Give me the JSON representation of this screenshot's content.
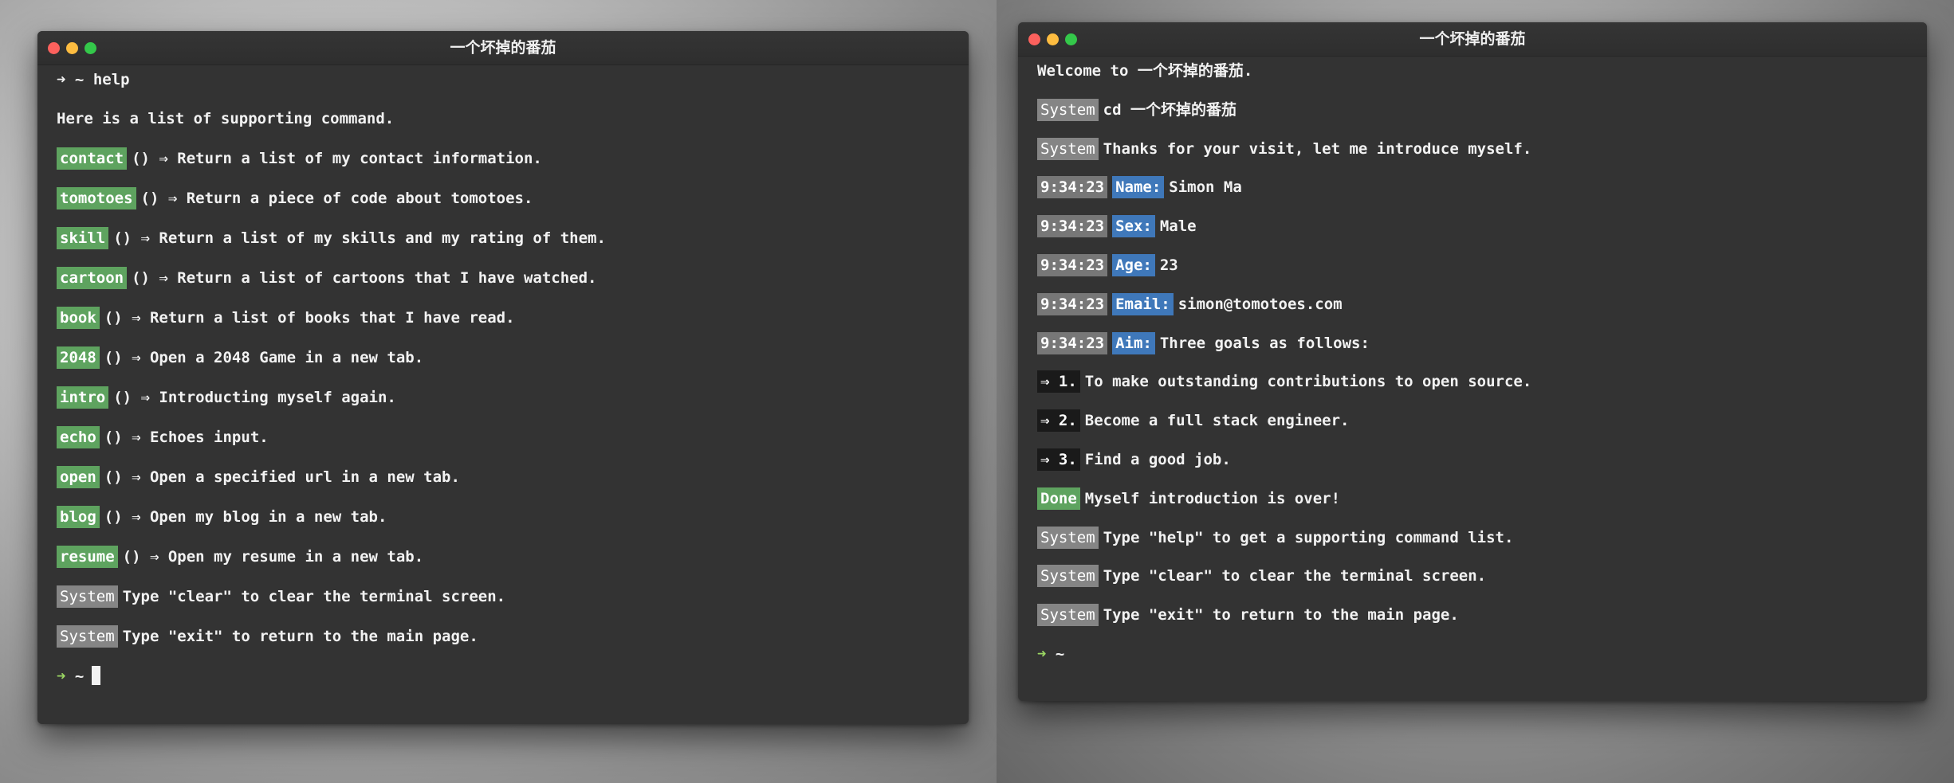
{
  "left_window": {
    "title": "一个坏掉的番茄",
    "command": {
      "arrow": "➜",
      "tilde": "~",
      "text": "help"
    },
    "intro": "Here is a list of supporting command.",
    "commands": [
      {
        "name": "contact",
        "sig": "() ⇒",
        "desc": "Return a list of my contact information."
      },
      {
        "name": "tomotoes",
        "sig": "() ⇒",
        "desc": "Return a piece of code about tomotoes."
      },
      {
        "name": "skill",
        "sig": "() ⇒",
        "desc": "Return a list of my skills and my rating of them."
      },
      {
        "name": "cartoon",
        "sig": "() ⇒",
        "desc": "Return a list of cartoons that I have watched."
      },
      {
        "name": "book",
        "sig": "() ⇒",
        "desc": "Return a list of books that I have read."
      },
      {
        "name": "2048",
        "sig": "() ⇒",
        "desc": "Open a 2048 Game in a new tab."
      },
      {
        "name": "intro",
        "sig": "() ⇒",
        "desc": "Introducting myself again."
      },
      {
        "name": "echo",
        "sig": "() ⇒",
        "desc": "Echoes input."
      },
      {
        "name": "open",
        "sig": "() ⇒",
        "desc": "Open a specified url in a new tab."
      },
      {
        "name": "blog",
        "sig": "() ⇒",
        "desc": "Open my blog in a new tab."
      },
      {
        "name": "resume",
        "sig": "() ⇒",
        "desc": "Open my resume in a new tab."
      }
    ],
    "system_lines": [
      {
        "tag": "System",
        "text": "Type \"clear\" to clear the terminal screen."
      },
      {
        "tag": "System",
        "text": "Type \"exit\" to return to the main page."
      }
    ],
    "prompt": {
      "arrow": "➜",
      "tilde": "~"
    }
  },
  "right_window": {
    "title": "一个坏掉的番茄",
    "welcome": "Welcome to 一个坏掉的番茄.",
    "system_1": {
      "tag": "System",
      "text": "cd 一个坏掉的番茄"
    },
    "system_2": {
      "tag": "System",
      "text": "Thanks for your visit, let me introduce myself."
    },
    "info": [
      {
        "time": "9:34:23",
        "label": "Name:",
        "value": "Simon Ma"
      },
      {
        "time": "9:34:23",
        "label": "Sex:",
        "value": "Male"
      },
      {
        "time": "9:34:23",
        "label": "Age:",
        "value": "23"
      },
      {
        "time": "9:34:23",
        "label": "Email:",
        "value": "simon@tomotoes.com"
      },
      {
        "time": "9:34:23",
        "label": "Aim:",
        "value": "Three goals as follows:"
      }
    ],
    "goals": [
      {
        "tag": "⇒ 1.",
        "text": "To make outstanding contributions to open source."
      },
      {
        "tag": "⇒ 2.",
        "text": "Become a full stack engineer."
      },
      {
        "tag": "⇒ 3.",
        "text": "Find a good job."
      }
    ],
    "done": {
      "tag": "Done",
      "text": "Myself introduction is over!"
    },
    "system_lines": [
      {
        "tag": "System",
        "text": "Type \"help\" to get a supporting command list."
      },
      {
        "tag": "System",
        "text": "Type \"clear\" to clear the terminal screen."
      },
      {
        "tag": "System",
        "text": "Type \"exit\" to return to the main page."
      }
    ],
    "prompt": {
      "arrow": "➜",
      "tilde": "~"
    }
  },
  "colors": {
    "terminal_bg": "#333333",
    "command_tag": "#5ea35f",
    "system_tag": "#858585",
    "label_tag": "#3f78ba",
    "prompt_arrow": "#9bd763"
  }
}
